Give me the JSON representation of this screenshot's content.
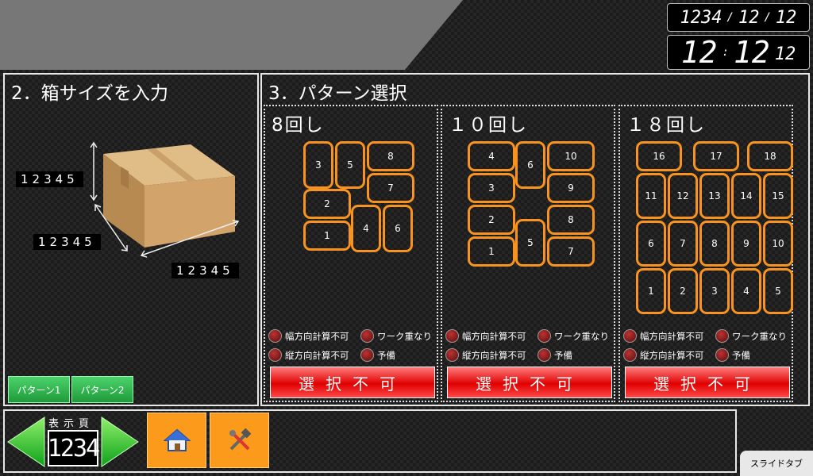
{
  "clock": {
    "date": [
      "1234",
      "12",
      "12"
    ],
    "time": [
      "12",
      "12"
    ],
    "seconds": "12"
  },
  "box_input": {
    "title": "2．箱サイズを入力",
    "height_value": "12345",
    "depth_value": "12345",
    "width_value": "12345",
    "buttons": [
      "パターン1",
      "パターン2"
    ]
  },
  "pattern_select": {
    "title": "3．パターン選択",
    "patterns": [
      {
        "name": "8回し",
        "boxes": [
          "3",
          "5",
          "8",
          "7",
          "2",
          "1",
          "4",
          "6"
        ]
      },
      {
        "name": "１０回し",
        "boxes": [
          "4",
          "6",
          "10",
          "3",
          "9",
          "2",
          "8",
          "1",
          "5",
          "7"
        ]
      },
      {
        "name": "１８回し",
        "boxes": [
          "16",
          "17",
          "18",
          "11",
          "12",
          "13",
          "14",
          "15",
          "6",
          "7",
          "8",
          "9",
          "10",
          "1",
          "2",
          "3",
          "4",
          "5"
        ]
      }
    ],
    "status_labels": [
      "幅方向計算不可",
      "ワーク重なり",
      "縦方向計算不可",
      "予備"
    ],
    "select_label": "選択不可"
  },
  "footer": {
    "page_label": "表示頁",
    "page_number": "1234",
    "slide_tab": "スライドタブ"
  },
  "icons": {
    "home": "home-icon",
    "tools": "tools-icon",
    "prev": "arrow-left-icon",
    "next": "arrow-right-icon"
  },
  "colors": {
    "box_border": "#f7931e",
    "select_button": "#e00000",
    "green_button": "#1f9a3b",
    "orange_button": "#fb9a1b"
  }
}
